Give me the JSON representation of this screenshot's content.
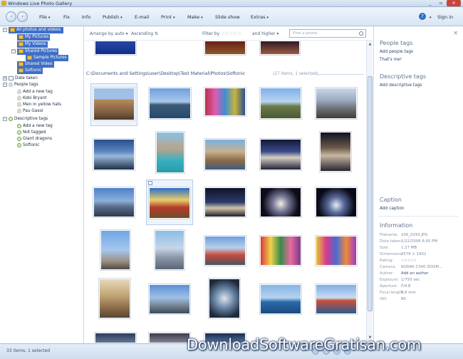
{
  "window": {
    "title": "Windows Live Photo Gallery"
  },
  "menu": {
    "items": [
      {
        "label": "File",
        "caret": true
      },
      {
        "label": "Fix",
        "caret": false
      },
      {
        "label": "Info",
        "caret": false
      },
      {
        "label": "Publish",
        "caret": true
      },
      {
        "label": "E-mail",
        "caret": false
      },
      {
        "label": "Print",
        "caret": true
      },
      {
        "label": "Make",
        "caret": true
      },
      {
        "label": "Slide show",
        "caret": false
      },
      {
        "label": "Extras",
        "caret": true
      }
    ],
    "sign_in": "Sign in"
  },
  "tree": {
    "all": "All photos and videos",
    "my_pictures": "My Pictures",
    "my_videos": "My Videos",
    "shared_pictures": "Shared Pictures",
    "sample_pictures": "Sample Pictures",
    "shared_video": "Shared Video",
    "softonic_folder": "Softonic",
    "date_taken": "Date taken",
    "people_tags": "People tags",
    "add_new_tag": "Add a new tag",
    "person1": "Kobi Bryant",
    "person2": "Men in yellow hats",
    "person3": "Pau Gasol",
    "descriptive_tags": "Descriptive tags",
    "add_new_tag2": "Add a new tag",
    "not_tagged": "Not tagged",
    "tag1": "Giant dragons",
    "tag2": "Softonic"
  },
  "gridbar": {
    "arrange": "Arrange by auto",
    "order": "Ascending",
    "filter": "Filter by",
    "higher": "and higher",
    "search_placeholder": "Find a photo"
  },
  "grid": {
    "folder_path": "C:\\Documents and Settings\\user\\Desktop\\Test Material\\Photos\\Softonic",
    "count": "(27 items, 1 selected)"
  },
  "pane": {
    "people_tags": "People tags",
    "add_people_tags": "Add people tags",
    "thats_me": "That's me!",
    "descriptive_tags": "Descriptive tags",
    "add_descriptive_tags": "Add descriptive tags",
    "caption": "Caption",
    "add_caption": "Add caption",
    "information": "Information",
    "info": [
      {
        "k": "Filename:",
        "v": "100_0293.JPG",
        "dark": false
      },
      {
        "k": "Date taken:",
        "v": "1/22/2006 6:50 PM",
        "dark": false
      },
      {
        "k": "Size:",
        "v": "1.27 MB",
        "dark": false
      },
      {
        "k": "Dimensions:",
        "v": "2576 × 1932",
        "dark": false
      },
      {
        "k": "Rating:",
        "v": "☆☆☆☆☆",
        "dark": false
      },
      {
        "k": "Camera:",
        "v": "KODAK C340 ZOOM...",
        "dark": false
      },
      {
        "k": "Author:",
        "v": "Add an author",
        "dark": true
      },
      {
        "k": "Exposure:",
        "v": "1/750 sec",
        "dark": false
      },
      {
        "k": "Aperture:",
        "v": "F/4.8",
        "dark": false
      },
      {
        "k": "Focal length:",
        "v": "5.6 mm",
        "dark": false
      },
      {
        "k": "ISO:",
        "v": "80",
        "dark": false
      }
    ]
  },
  "status": {
    "text": "33 items, 1 selected"
  },
  "watermark": "DownloadSoftwareGratisan.com"
}
